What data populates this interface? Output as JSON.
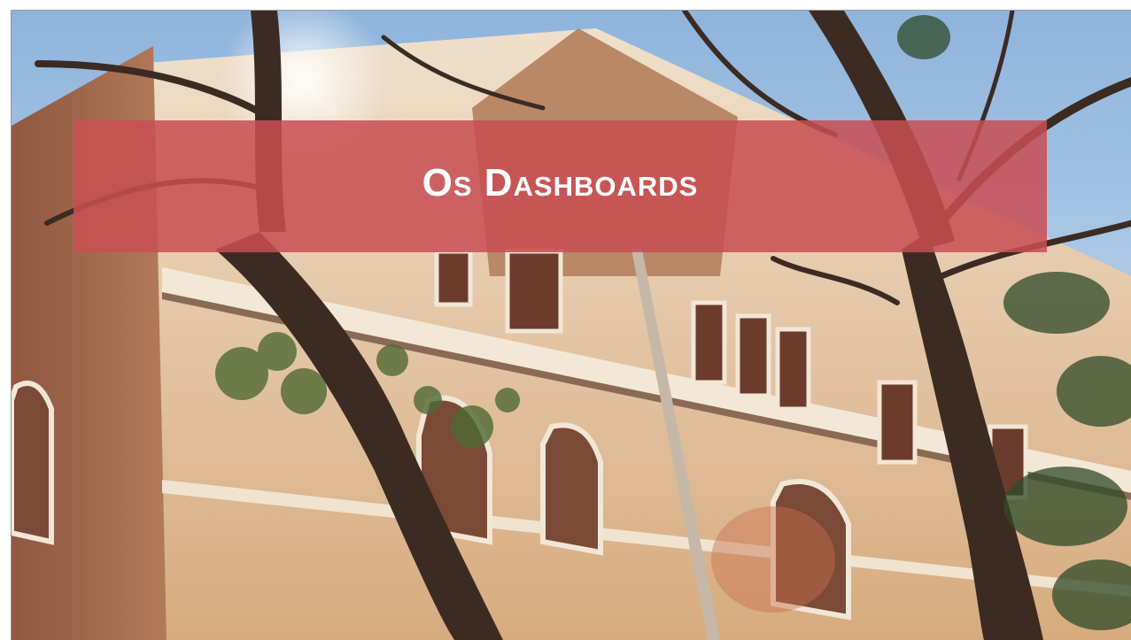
{
  "slide": {
    "title": "Os Dashboards",
    "background": "photo-building-with-trees",
    "banner_color": "#c84e54",
    "sky_color": "#a9c8e6",
    "brick_color": "#d9b98f"
  }
}
